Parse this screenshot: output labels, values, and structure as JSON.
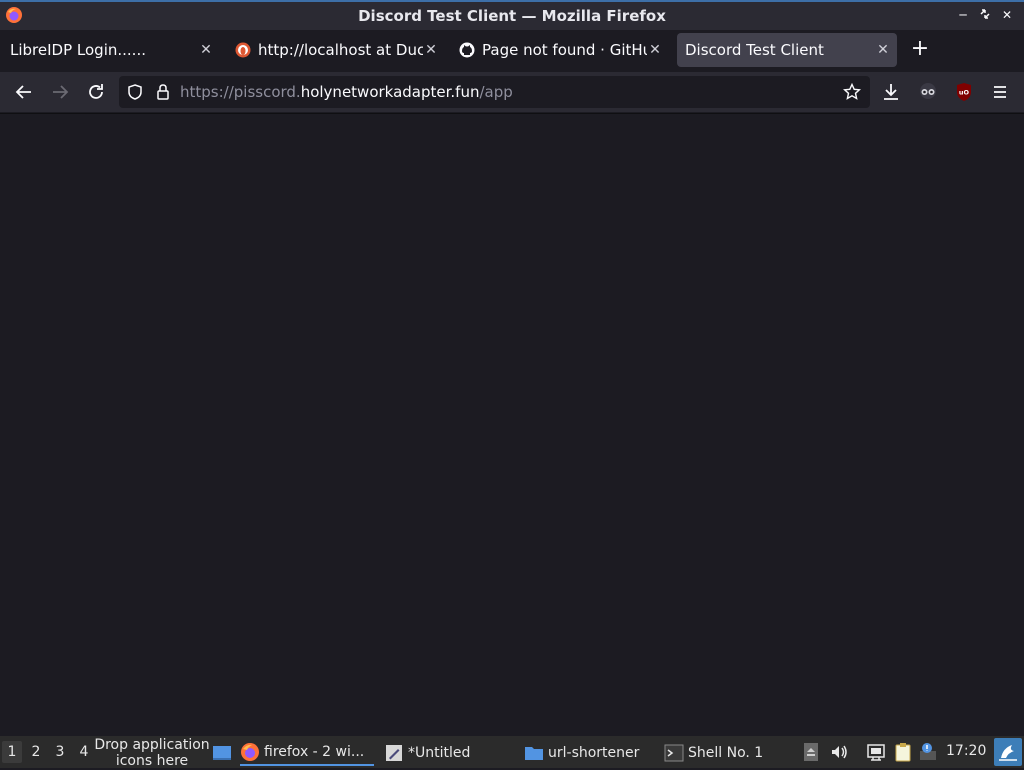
{
  "window": {
    "title": "Discord Test Client — Mozilla Firefox"
  },
  "tabs": [
    {
      "label": "LibreIDP Login......",
      "favicon": "none",
      "active": false
    },
    {
      "label": "http://localhost at Duck",
      "favicon": "duckduckgo-icon",
      "active": false
    },
    {
      "label": "Page not found · GitHu",
      "favicon": "github-icon",
      "active": false
    },
    {
      "label": "Discord Test Client",
      "favicon": "none",
      "active": true
    }
  ],
  "urlbar": {
    "scheme_prefix": "https://pisscord.",
    "host": "holynetworkadapter.fun",
    "path": "/app"
  },
  "taskbar": {
    "workspaces": [
      "1",
      "2",
      "3",
      "4"
    ],
    "active_workspace": "1",
    "drop_hint": "Drop application icons here",
    "tasks": [
      {
        "label": "firefox - 2 wi...",
        "icon": "firefox-icon"
      },
      {
        "label": "*Untitled",
        "icon": "text-editor-icon"
      },
      {
        "label": "url-shortener",
        "icon": "folder-icon"
      },
      {
        "label": "Shell No. 1",
        "icon": "terminal-icon"
      }
    ],
    "clock": "17:20"
  },
  "colors": {
    "accent": "#3d6fa8",
    "tab_active_bg": "#42414d",
    "content_bg": "#1c1b22"
  }
}
